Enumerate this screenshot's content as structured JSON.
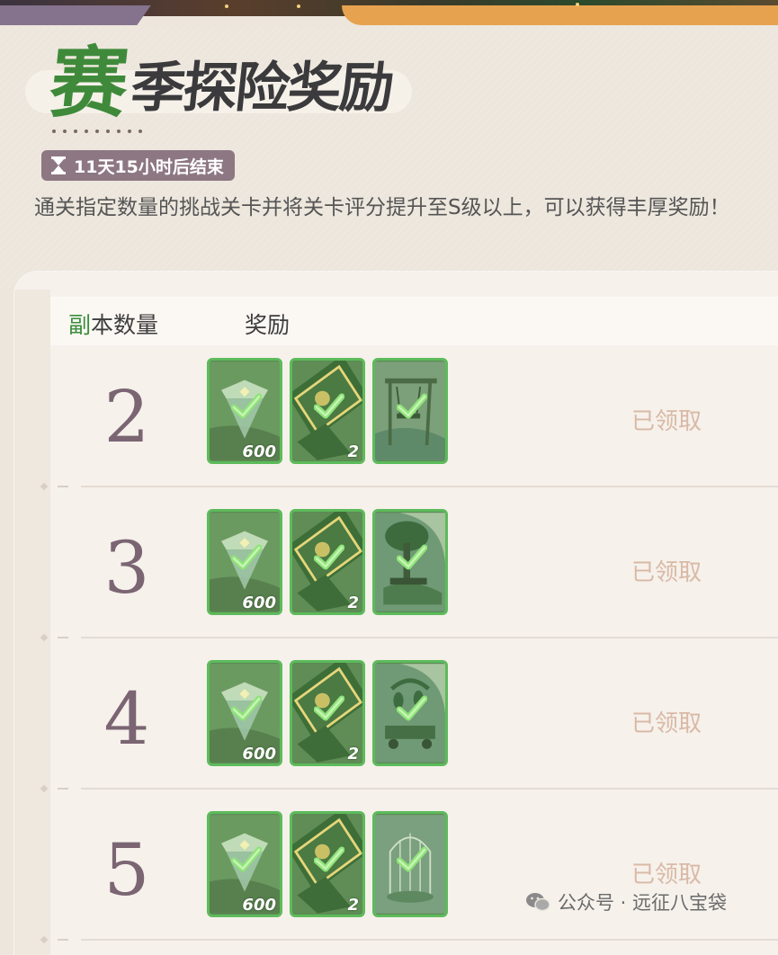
{
  "title": {
    "first_char": "赛",
    "rest": "季探险奖励"
  },
  "timer": {
    "text": "11天15小时后结束",
    "icon": "hourglass-icon"
  },
  "description": "通关指定数量的挑战关卡并将关卡评分提升至S级以上，可以获得丰厚奖励！",
  "table": {
    "header": {
      "count_label_accent": "副",
      "count_label_rest": "本数量",
      "reward_label": "奖励"
    },
    "rows": [
      {
        "count": "2",
        "rewards": [
          {
            "kind": "gem",
            "qty": "600"
          },
          {
            "kind": "ticket",
            "qty": "2"
          },
          {
            "kind": "furniture-swing",
            "qty": ""
          }
        ],
        "status": "已领取"
      },
      {
        "count": "3",
        "rewards": [
          {
            "kind": "gem",
            "qty": "600"
          },
          {
            "kind": "ticket",
            "qty": "2"
          },
          {
            "kind": "furniture-tree-bench",
            "qty": ""
          }
        ],
        "status": "已领取"
      },
      {
        "count": "4",
        "rewards": [
          {
            "kind": "gem",
            "qty": "600"
          },
          {
            "kind": "ticket",
            "qty": "2"
          },
          {
            "kind": "furniture-plant-cart",
            "qty": ""
          }
        ],
        "status": "已领取"
      },
      {
        "count": "5",
        "rewards": [
          {
            "kind": "gem",
            "qty": "600"
          },
          {
            "kind": "ticket",
            "qty": "2"
          },
          {
            "kind": "furniture-birdcage",
            "qty": ""
          }
        ],
        "status": "已领取"
      }
    ]
  },
  "watermark": "公众号 · 远征八宝袋",
  "colors": {
    "accent_green": "#3f8a3a",
    "card_border": "#5dbb5b",
    "claimed_text": "#d9b9a6",
    "number_text": "#7b6573"
  }
}
